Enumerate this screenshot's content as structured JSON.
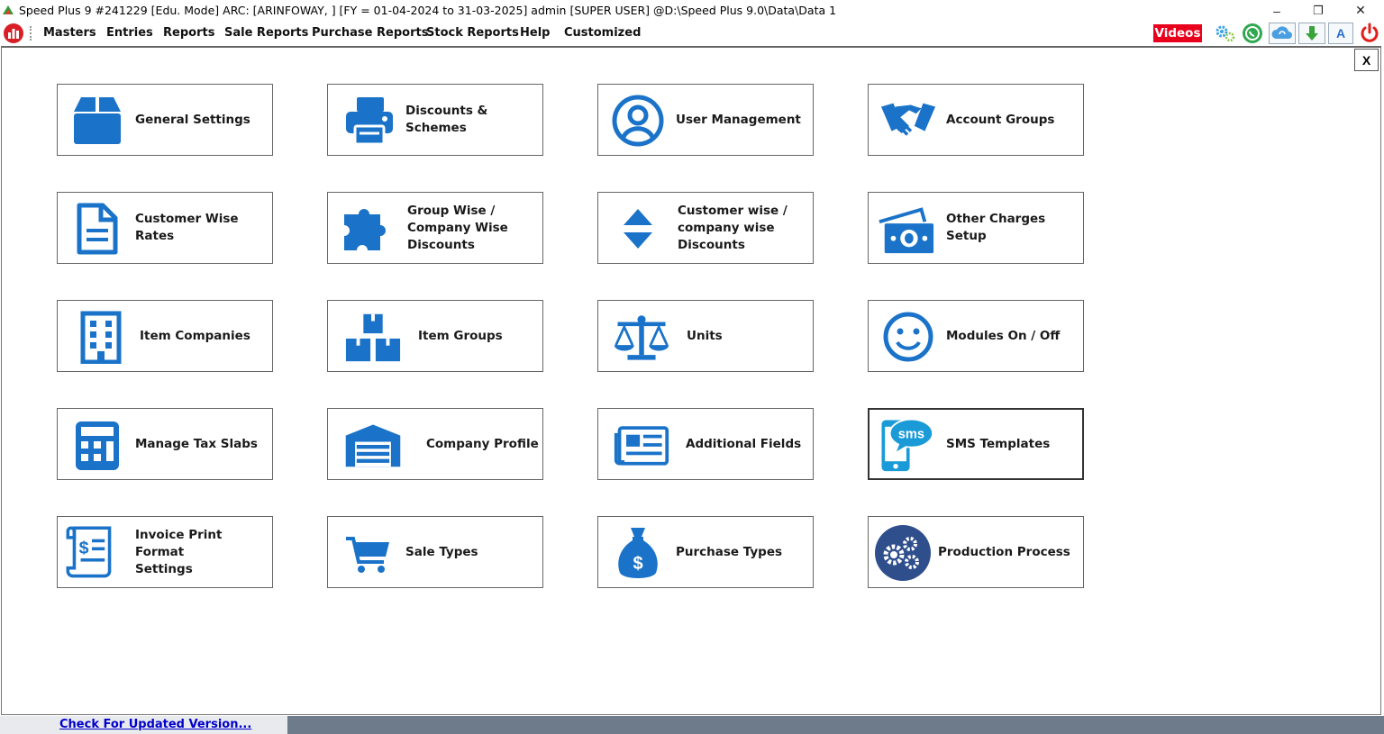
{
  "window": {
    "title": "Speed Plus 9 #241229  [Edu. Mode] ARC:   [ARINFOWAY, ] [FY = 01-04-2024 to 31-03-2025] admin [SUPER USER]  @D:\\Speed Plus 9.0\\Data\\Data 1",
    "minimize": "–",
    "restore": "❐",
    "close": "✕"
  },
  "menu": [
    "Masters",
    "Entries",
    "Reports",
    "Sale Reports",
    "Purchase Reports",
    "Stock Reports",
    "Help",
    "Customized"
  ],
  "toolbar": {
    "videos_label": "Videos",
    "font_button_label": "A",
    "icons": [
      "settings-gears-icon",
      "whatsapp-icon",
      "cloud-sync-icon",
      "download-arrow-icon",
      "font-icon",
      "power-icon"
    ]
  },
  "panel_close_label": "X",
  "tiles": [
    {
      "label": "General Settings",
      "icon": "box-icon"
    },
    {
      "label": "Discounts & Schemes",
      "icon": "printer-icon"
    },
    {
      "label": "User Management",
      "icon": "user-circle-icon"
    },
    {
      "label": "Account Groups",
      "icon": "handshake-icon"
    },
    {
      "label": "Customer Wise Rates",
      "icon": "document-icon"
    },
    {
      "label": "Group Wise /\nCompany Wise\nDiscounts",
      "icon": "puzzle-icon"
    },
    {
      "label": "Customer wise /\ncompany wise\nDiscounts",
      "icon": "sort-arrows-icon"
    },
    {
      "label": "Other Charges Setup",
      "icon": "money-icon"
    },
    {
      "label": "Item Companies",
      "icon": "building-icon"
    },
    {
      "label": "Item Groups",
      "icon": "boxes-icon"
    },
    {
      "label": "Units",
      "icon": "balance-scale-icon"
    },
    {
      "label": "Modules On / Off",
      "icon": "smile-icon"
    },
    {
      "label": "Manage Tax Slabs",
      "icon": "calculator-icon"
    },
    {
      "label": "Company Profile",
      "icon": "warehouse-icon"
    },
    {
      "label": "Additional Fields",
      "icon": "newspaper-icon"
    },
    {
      "label": "SMS Templates",
      "icon": "sms-phone-icon",
      "sms_text": "sms"
    },
    {
      "label": "Invoice Print Format\nSettings",
      "icon": "invoice-scroll-icon"
    },
    {
      "label": "Sale Types",
      "icon": "cart-icon"
    },
    {
      "label": "Purchase Types",
      "icon": "money-bag-icon"
    },
    {
      "label": "Production Process",
      "icon": "gears-icon"
    }
  ],
  "status": {
    "update_link": "Check For Updated Version..."
  },
  "colors": {
    "icon_blue": "#1a73c9",
    "menu_bar_bg": "#ffffff",
    "videos_bg": "#e8001c",
    "status_dark": "#6e7b8b",
    "link": "#0000cc"
  }
}
